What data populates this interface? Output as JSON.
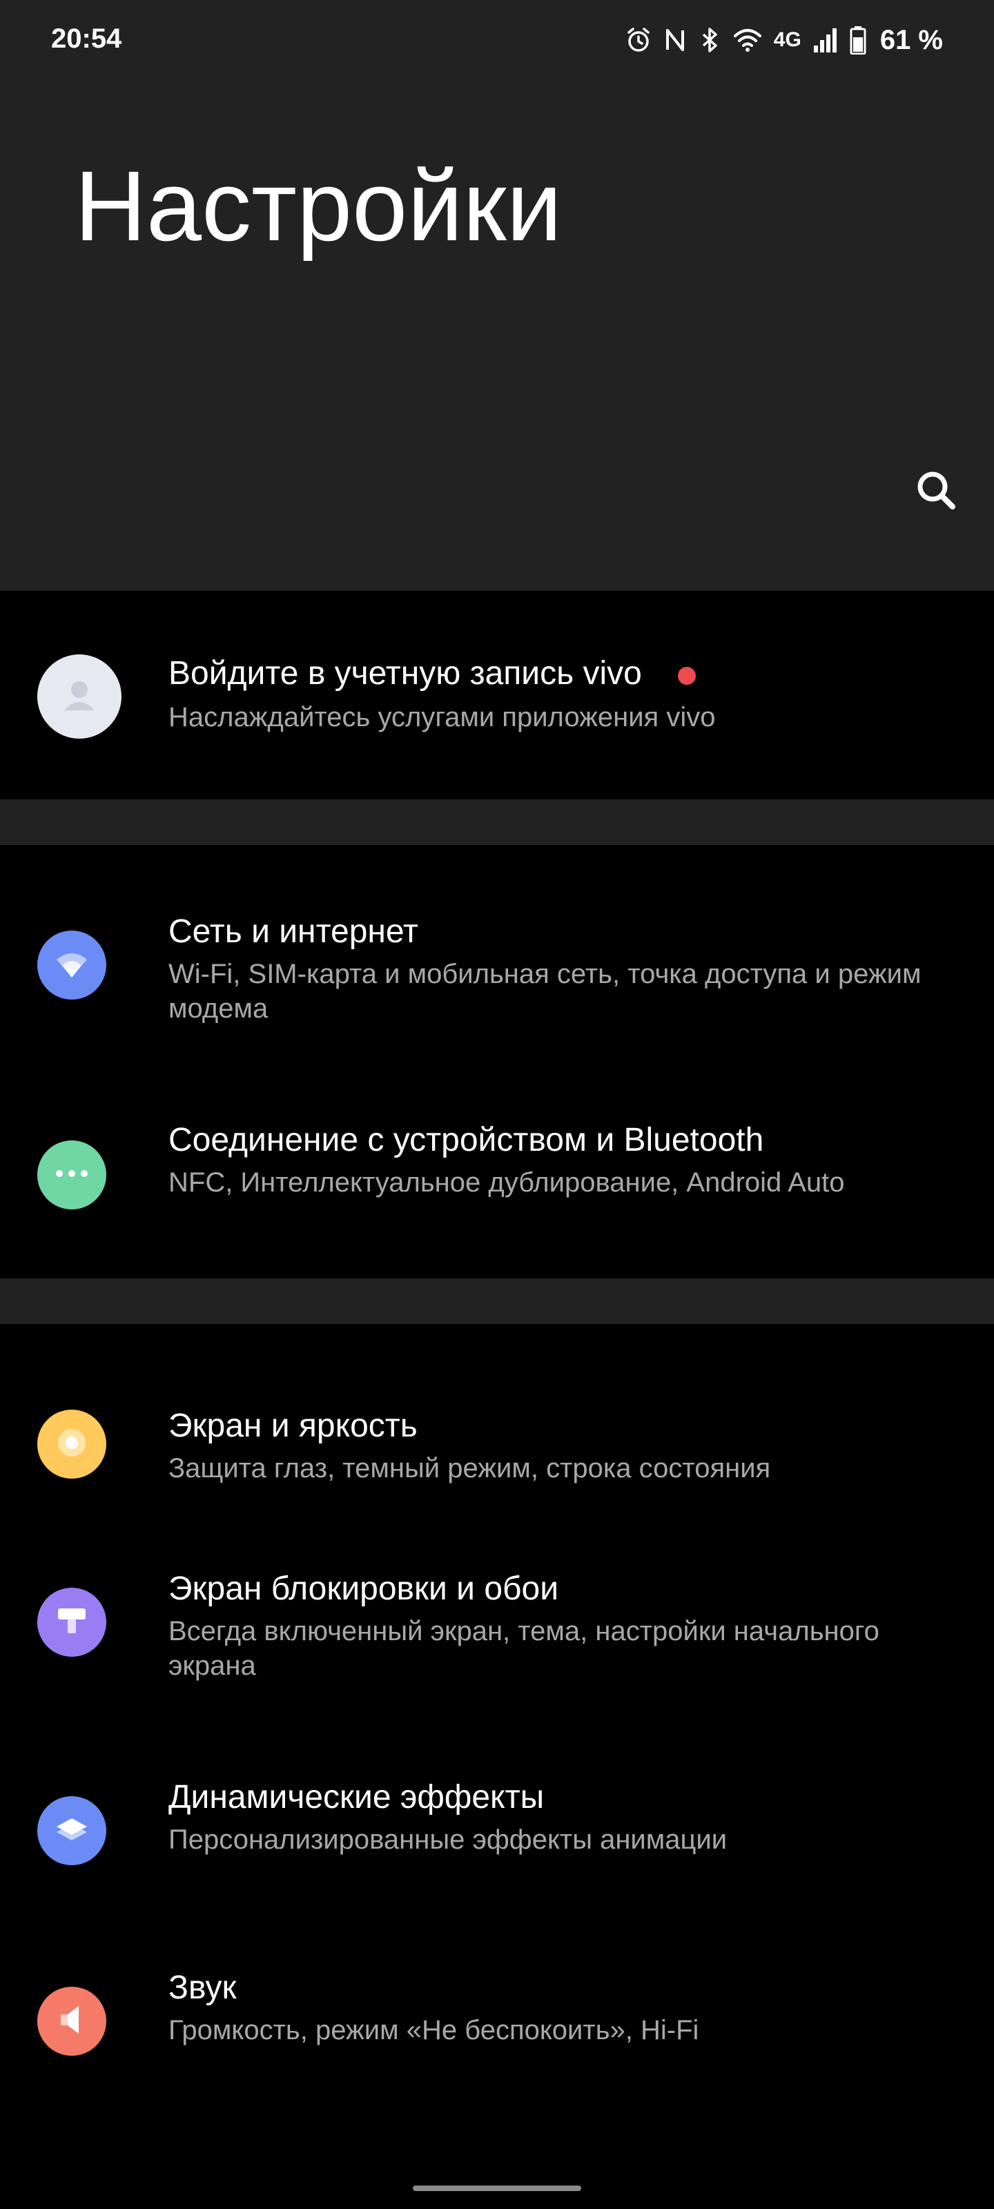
{
  "status_bar": {
    "time": "20:54",
    "network": "4G",
    "battery": "61 %"
  },
  "header": {
    "title": "Настройки"
  },
  "account": {
    "title": "Войдите в учетную запись vivo",
    "subtitle": "Наслаждайтесь услугами приложения vivo"
  },
  "settings": [
    {
      "title": "Сеть и интернет",
      "subtitle": "Wi-Fi, SIM-карта и мобильная сеть, точка доступа и режим модема",
      "icon": "wifi-icon",
      "color": "#6b8cf5"
    },
    {
      "title": "Соединение с устройством и Bluetooth",
      "subtitle": "NFC, Интеллектуальное дублирование, Android Auto",
      "icon": "more-dots-icon",
      "color": "#6fd6a4"
    },
    {
      "title": "Экран и яркость",
      "subtitle": "Защита глаз, темный режим, строка состояния",
      "icon": "brightness-icon",
      "color": "#ffc95c"
    },
    {
      "title": "Экран блокировки и обои",
      "subtitle": "Всегда включенный экран, тема, настройки начального экрана",
      "icon": "paint-roller-icon",
      "color": "#9a7df2"
    },
    {
      "title": "Динамические эффекты",
      "subtitle": "Персонализированные эффекты анимации",
      "icon": "layers-icon",
      "color": "#6b8cf5"
    },
    {
      "title": "Звук",
      "subtitle": "Громкость, режим «Не беспокоить», Hi-Fi",
      "icon": "speaker-icon",
      "color": "#f57a68"
    }
  ],
  "colors": {
    "background": "#000000",
    "header": "#222222",
    "subtitle": "#a8a8a8",
    "notification_dot": "#ee4a4f"
  }
}
